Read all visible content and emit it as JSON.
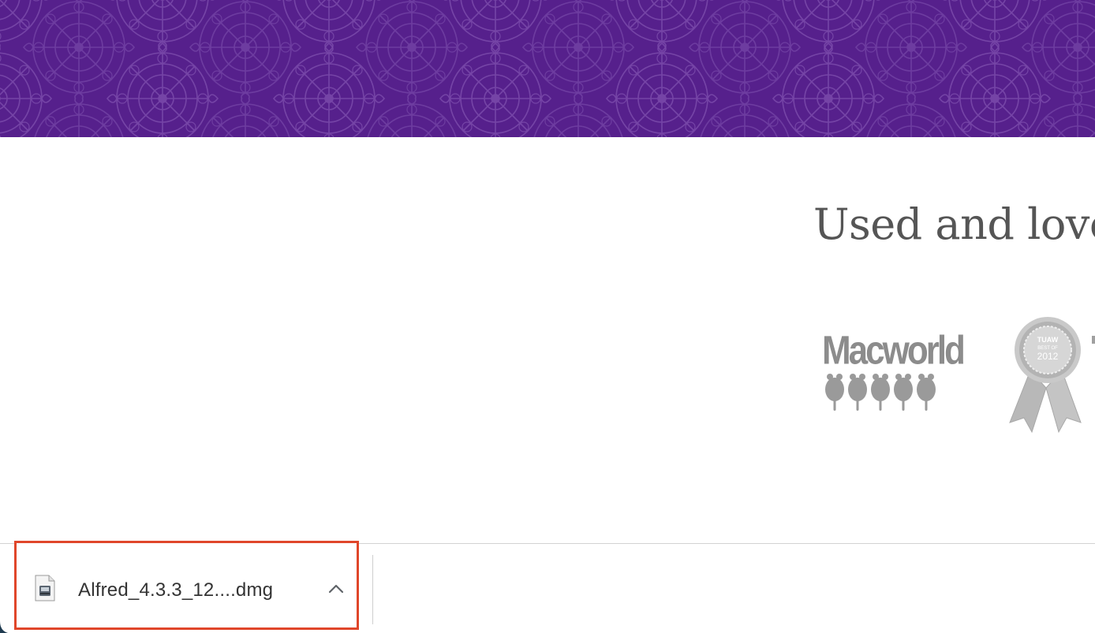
{
  "banner": {
    "color": "#56208c",
    "pattern_color": "#7a4aab"
  },
  "main": {
    "headline": "Used and love",
    "badges": [
      {
        "name": "Macworld",
        "text": "Macworld",
        "rating_mice": 5
      },
      {
        "name": "TUAW Best of 2012",
        "line1": "TUAW",
        "line2": "BEST OF",
        "line3": "2012"
      }
    ]
  },
  "download_shelf": {
    "item": {
      "file_name": "Alfred_4.3.3_12....dmg",
      "icon": "disk-image-icon",
      "chevron_icon": "chevron-up-icon"
    },
    "highlight_color": "#e0462a"
  }
}
